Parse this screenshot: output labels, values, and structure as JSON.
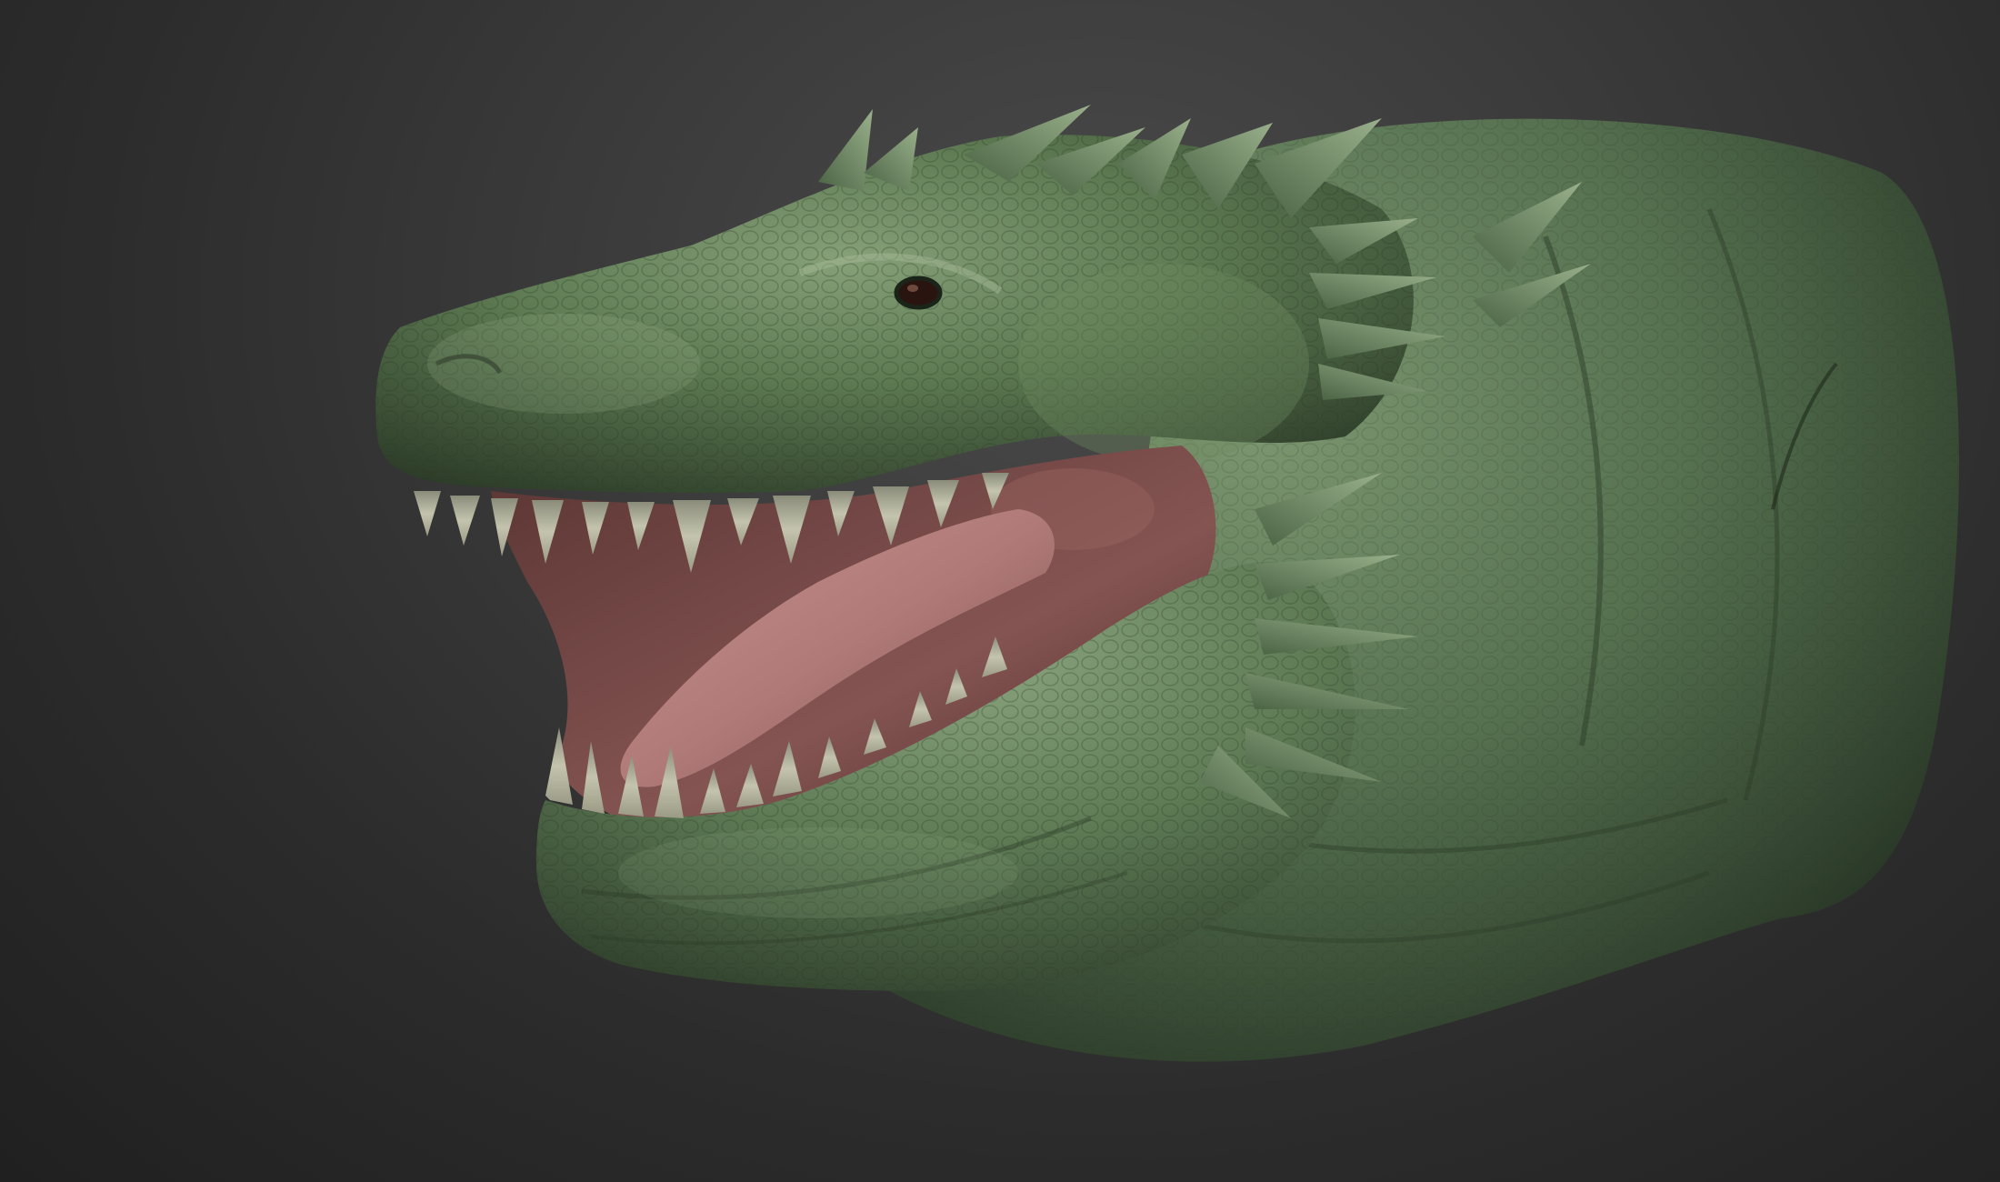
{
  "scene": {
    "subject": "sculpted-creature-head",
    "colors": {
      "background_top": "#4a4a4a",
      "background_bottom": "#202020",
      "skin_main": "#4f6a44",
      "skin_light": "#7e9a70",
      "skin_dark": "#2a3a25",
      "mouth_inner": "#7a4a48",
      "tongue": "#b07a78",
      "teeth": "#b8b8a2",
      "eye": "#2a1410"
    }
  }
}
